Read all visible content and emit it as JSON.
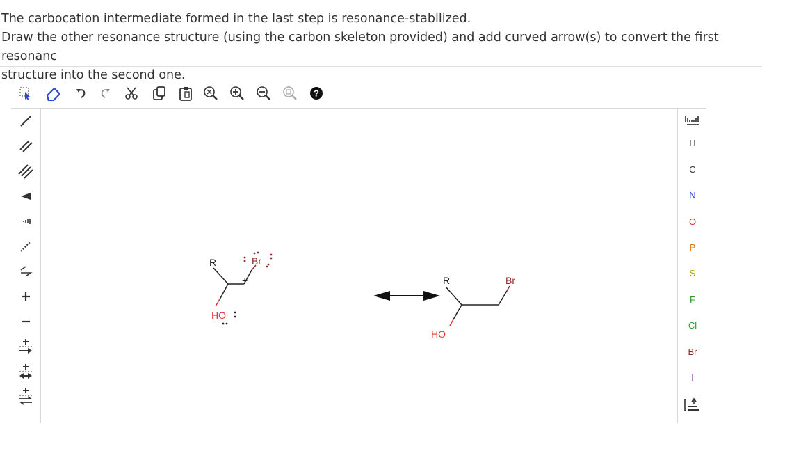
{
  "question": {
    "line1": "The carbocation intermediate formed in the last step is resonance-stabilized.",
    "line2": "Draw the other resonance structure (using the carbon skeleton provided) and add curved arrow(s) to convert the first resonanc",
    "line3": "structure into the second one."
  },
  "toolbar": {
    "items": [
      "select-icon",
      "erase-icon",
      "undo-icon",
      "redo-icon",
      "cut-icon",
      "copy-icon",
      "paste-icon",
      "zoom-fit-icon",
      "zoom-in-icon",
      "zoom-out-icon",
      "zoom-reset-icon",
      "help-icon"
    ]
  },
  "left_tools": [
    "single-bond",
    "double-bond",
    "triple-bond",
    "wedge-bond",
    "hash-bond",
    "dashed-bond",
    "any-bond",
    "plus-charge",
    "minus-charge",
    "arrow-plus-1",
    "arrow-plus-2",
    "arrow-plus-3"
  ],
  "elements": {
    "H": "H",
    "C": "C",
    "N": "N",
    "O": "O",
    "P": "P",
    "S": "S",
    "F": "F",
    "Cl": "Cl",
    "Br": "Br",
    "I": "I"
  },
  "structure1": {
    "R": "R",
    "Br": "Br",
    "HO": "HO",
    "plus": "+"
  },
  "structure2": {
    "R": "R",
    "Br": "Br",
    "HO": "HO"
  },
  "colors": {
    "oxygen": "#e8332e",
    "bromine": "#8b2a2a",
    "bond": "#222222",
    "accent": "#2a4ad8"
  }
}
